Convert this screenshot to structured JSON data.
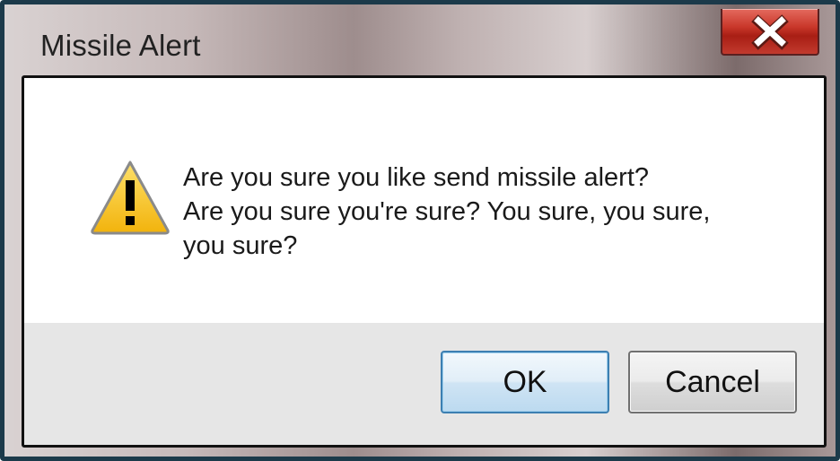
{
  "window": {
    "title": "Missile Alert",
    "close_label": "X"
  },
  "icons": {
    "close": "close-icon",
    "warning": "warning-icon"
  },
  "message": {
    "lines": [
      "Are you sure you like send missile alert?",
      "Are you sure you're sure? You sure, you sure,",
      "you sure?"
    ]
  },
  "buttons": {
    "ok_label": "OK",
    "cancel_label": "Cancel"
  },
  "colors": {
    "close_button": "#c9372a",
    "ok_border": "#3c7fb1",
    "warning_fill": "#f7c21a",
    "frame": "#1c3a4a"
  }
}
